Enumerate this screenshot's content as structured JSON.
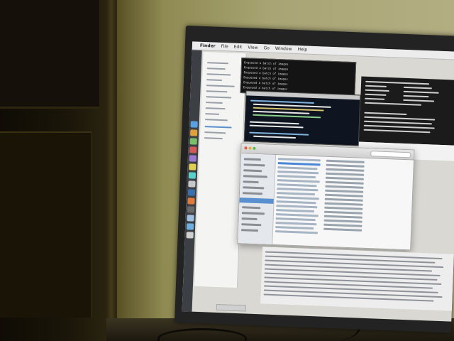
{
  "scene": {
    "description_tags": [
      "room-wall",
      "cabinet",
      "computer-monitor",
      "desk",
      "cables"
    ]
  },
  "screen": {
    "menu_bar": {
      "apple_glyph": "",
      "items": [
        "Finder",
        "File",
        "Edit",
        "View",
        "Go",
        "Window",
        "Help"
      ]
    },
    "terminal": {
      "lines": [
        "Enqueued a batch of images",
        "Enqueued a batch of images",
        "Enqueued a batch of images",
        "Enqueued a batch of images",
        "Enqueued a batch of images",
        "Enqueued a batch of images"
      ]
    },
    "colors": {
      "screen_bg": "#d9d8d2",
      "finder_selected": "#5a8fd0",
      "editor_bg": "#0e1420",
      "terminal_bg": "#141414"
    }
  }
}
